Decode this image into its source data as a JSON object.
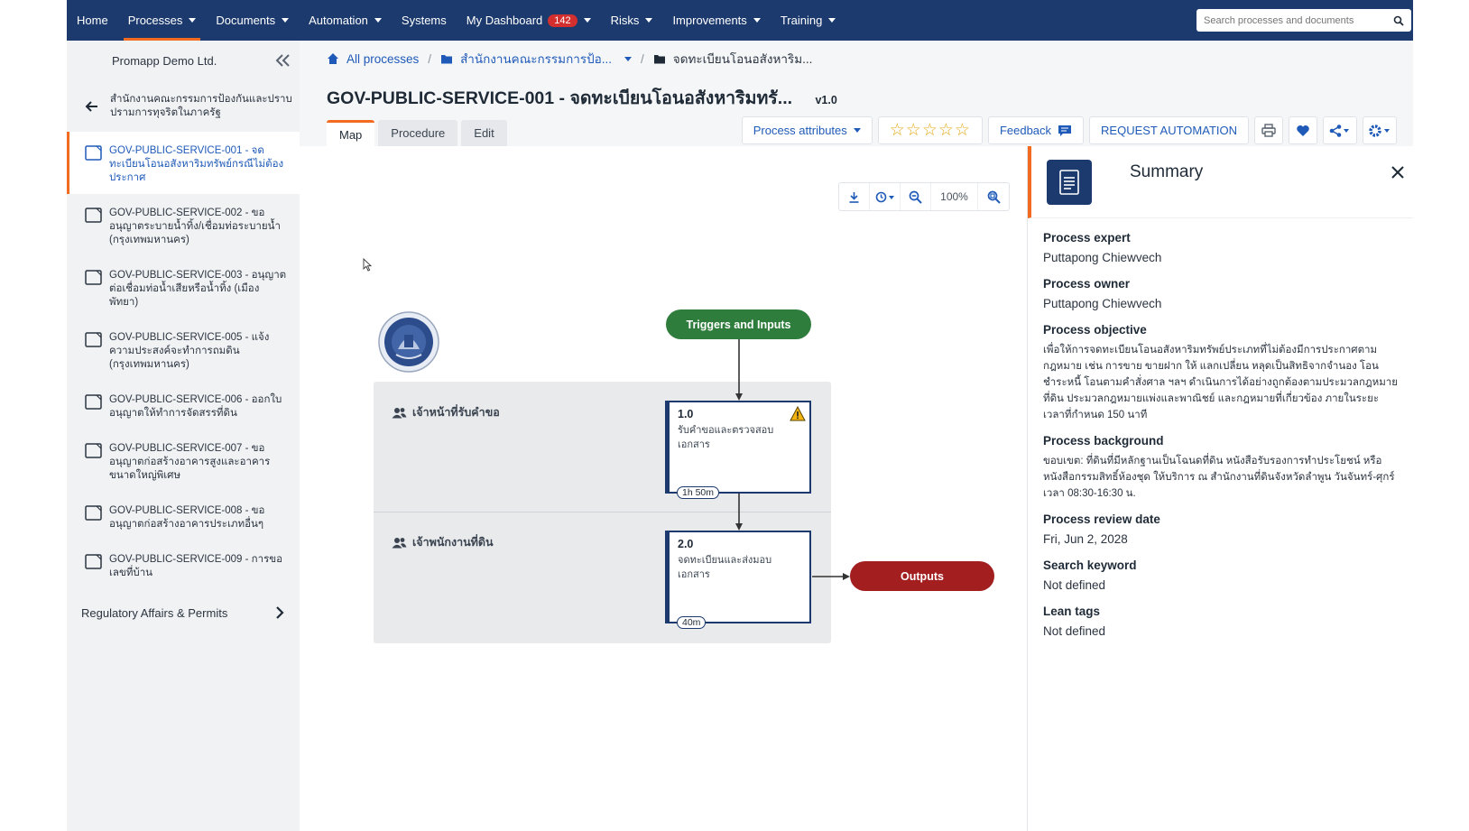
{
  "nav": {
    "home": "Home",
    "processes": "Processes",
    "documents": "Documents",
    "automation": "Automation",
    "systems": "Systems",
    "dashboard": "My Dashboard",
    "dashboard_count": "142",
    "risks": "Risks",
    "improvements": "Improvements",
    "training": "Training",
    "search_placeholder": "Search processes and documents"
  },
  "sidebar": {
    "org": "Promapp Demo Ltd.",
    "parent": "สำนักงานคณะกรรมการป้องกันและปราบปรามการทุจริตในภาครัฐ",
    "items": [
      {
        "label": "GOV-PUBLIC-SERVICE-001 - จดทะเบียนโอนอสังหาริมทรัพย์กรณีไม่ต้องประกาศ"
      },
      {
        "label": "GOV-PUBLIC-SERVICE-002 - ขออนุญาตระบายน้ำทิ้ง/เชื่อมท่อระบายน้ำ (กรุงเทพมหานคร)"
      },
      {
        "label": "GOV-PUBLIC-SERVICE-003 - อนุญาตต่อเชื่อมท่อน้ำเสียหรือน้ำทิ้ง (เมืองพัทยา)"
      },
      {
        "label": "GOV-PUBLIC-SERVICE-005 - แจ้งความประสงค์จะทำการถมดิน (กรุงเทพมหานคร)"
      },
      {
        "label": "GOV-PUBLIC-SERVICE-006 - ออกใบอนุญาตให้ทำการจัดสรรที่ดิน"
      },
      {
        "label": "GOV-PUBLIC-SERVICE-007 - ขออนุญาตก่อสร้างอาคารสูงและอาคารขนาดใหญ่พิเศษ"
      },
      {
        "label": "GOV-PUBLIC-SERVICE-008 - ขออนุญาตก่อสร้างอาคารประเภทอื่นๆ"
      },
      {
        "label": "GOV-PUBLIC-SERVICE-009 - การขอเลขที่บ้าน"
      }
    ],
    "group": "Regulatory Affairs & Permits"
  },
  "breadcrumb": {
    "all": "All processes",
    "group": "สำนักงานคณะกรรมการป้อ...",
    "current": "จดทะเบียนโอนอสังหาริม..."
  },
  "page": {
    "title": "GOV-PUBLIC-SERVICE-001 - จดทะเบียนโอนอสังหาริมทรั...",
    "version": "v1.0"
  },
  "tabs": [
    "Map",
    "Procedure",
    "Edit"
  ],
  "toolbar": {
    "attributes": "Process attributes",
    "stars": "☆☆☆☆☆",
    "feedback": "Feedback",
    "request": "REQUEST AUTOMATION"
  },
  "map": {
    "zoom": "100%",
    "trigger": "Triggers and Inputs",
    "outputs": "Outputs",
    "lanes": [
      "เจ้าหน้าที่รับคำขอ",
      "เจ้าพนักงานที่ดิน"
    ],
    "activities": [
      {
        "num": "1.0",
        "desc": "รับคำขอและตรวจสอบเอกสาร",
        "duration": "1h 50m"
      },
      {
        "num": "2.0",
        "desc": "จดทะเบียนและส่งมอบเอกสาร",
        "duration": "40m"
      }
    ]
  },
  "summary": {
    "title": "Summary",
    "fields": [
      {
        "label": "Process expert",
        "value": "Puttapong Chiewvech"
      },
      {
        "label": "Process owner",
        "value": "Puttapong Chiewvech"
      },
      {
        "label": "Process objective",
        "value": "เพื่อให้การจดทะเบียนโอนอสังหาริมทรัพย์ประเภทที่ไม่ต้องมีการประกาศตามกฎหมาย เช่น การขาย ขายฝาก ให้ แลกเปลี่ยน หลุดเป็นสิทธิจากจำนอง โอนชำระหนี้ โอนตามคำสั่งศาล ฯลฯ ดำเนินการได้อย่างถูกต้องตามประมวลกฎหมายที่ดิน ประมวลกฎหมายแพ่งและพาณิชย์ และกฎหมายที่เกี่ยวข้อง ภายในระยะเวลาที่กำหนด 150 นาที"
      },
      {
        "label": "Process background",
        "value": "ขอบเขต: ที่ดินที่มีหลักฐานเป็นโฉนดที่ดิน หนังสือรับรองการทำประโยชน์ หรือหนังสือกรรมสิทธิ์ห้องชุด ให้บริการ ณ สำนักงานที่ดินจังหวัดลำพูน วันจันทร์-ศุกร์ เวลา 08:30-16:30 น."
      },
      {
        "label": "Process review date",
        "value": "Fri, Jun 2, 2028"
      },
      {
        "label": "Search keyword",
        "value": "Not defined"
      },
      {
        "label": "Lean tags",
        "value": "Not defined"
      }
    ]
  }
}
